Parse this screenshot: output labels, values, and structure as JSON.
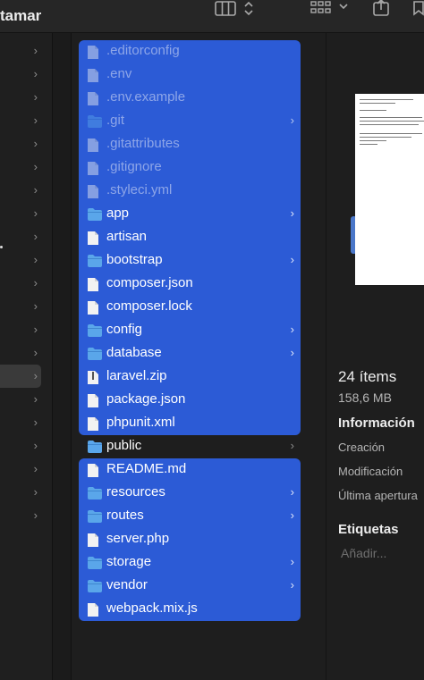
{
  "toolbar": {
    "title": "tamar",
    "icons": [
      "column-view-icon",
      "stepper-icon",
      "grid-view-icon",
      "chevron-down-icon",
      "share-icon",
      "tag-icon"
    ]
  },
  "files": [
    {
      "name": ".editorconfig",
      "kind": "file",
      "hidden": true,
      "selected": true
    },
    {
      "name": ".env",
      "kind": "file",
      "hidden": true,
      "selected": true
    },
    {
      "name": ".env.example",
      "kind": "file",
      "hidden": true,
      "selected": true
    },
    {
      "name": ".git",
      "kind": "folder",
      "hidden": true,
      "selected": true,
      "chevron": "›"
    },
    {
      "name": ".gitattributes",
      "kind": "file",
      "hidden": true,
      "selected": true
    },
    {
      "name": ".gitignore",
      "kind": "file",
      "hidden": true,
      "selected": true
    },
    {
      "name": ".styleci.yml",
      "kind": "file",
      "hidden": true,
      "selected": true
    },
    {
      "name": "app",
      "kind": "folder",
      "hidden": false,
      "selected": true,
      "chevron": "›"
    },
    {
      "name": "artisan",
      "kind": "file",
      "hidden": false,
      "selected": true
    },
    {
      "name": "bootstrap",
      "kind": "folder",
      "hidden": false,
      "selected": true,
      "chevron": "›"
    },
    {
      "name": "composer.json",
      "kind": "file",
      "hidden": false,
      "selected": true
    },
    {
      "name": "composer.lock",
      "kind": "file",
      "hidden": false,
      "selected": true
    },
    {
      "name": "config",
      "kind": "folder",
      "hidden": false,
      "selected": true,
      "chevron": "›"
    },
    {
      "name": "database",
      "kind": "folder",
      "hidden": false,
      "selected": true,
      "chevron": "›"
    },
    {
      "name": "laravel.zip",
      "kind": "zip",
      "hidden": false,
      "selected": true
    },
    {
      "name": "package.json",
      "kind": "file",
      "hidden": false,
      "selected": true
    },
    {
      "name": "phpunit.xml",
      "kind": "file",
      "hidden": false,
      "selected": true
    },
    {
      "name": "public",
      "kind": "folder",
      "hidden": false,
      "selected": false,
      "chevron": "›"
    },
    {
      "name": "README.md",
      "kind": "file",
      "hidden": false,
      "selected": true
    },
    {
      "name": "resources",
      "kind": "folder",
      "hidden": false,
      "selected": true,
      "chevron": "›"
    },
    {
      "name": "routes",
      "kind": "folder",
      "hidden": false,
      "selected": true,
      "chevron": "›"
    },
    {
      "name": "server.php",
      "kind": "file",
      "hidden": false,
      "selected": true
    },
    {
      "name": "storage",
      "kind": "folder",
      "hidden": false,
      "selected": true,
      "chevron": "›"
    },
    {
      "name": "vendor",
      "kind": "folder",
      "hidden": false,
      "selected": true,
      "chevron": "›"
    },
    {
      "name": "webpack.mix.js",
      "kind": "file",
      "hidden": false,
      "selected": true
    }
  ],
  "sidebar_chevron": "›",
  "preview": {
    "item_count": "24 ítems",
    "size": "158,6 MB",
    "info_heading": "Información",
    "created_label": "Creación",
    "modified_label": "Modificación",
    "last_opened_label": "Última apertura",
    "tags_heading": "Etiquetas",
    "add_tag_placeholder": "Añadir..."
  },
  "colors": {
    "selection": "#2c5bd6",
    "folder": "#5aa6ea",
    "background": "#1e1e1e"
  }
}
